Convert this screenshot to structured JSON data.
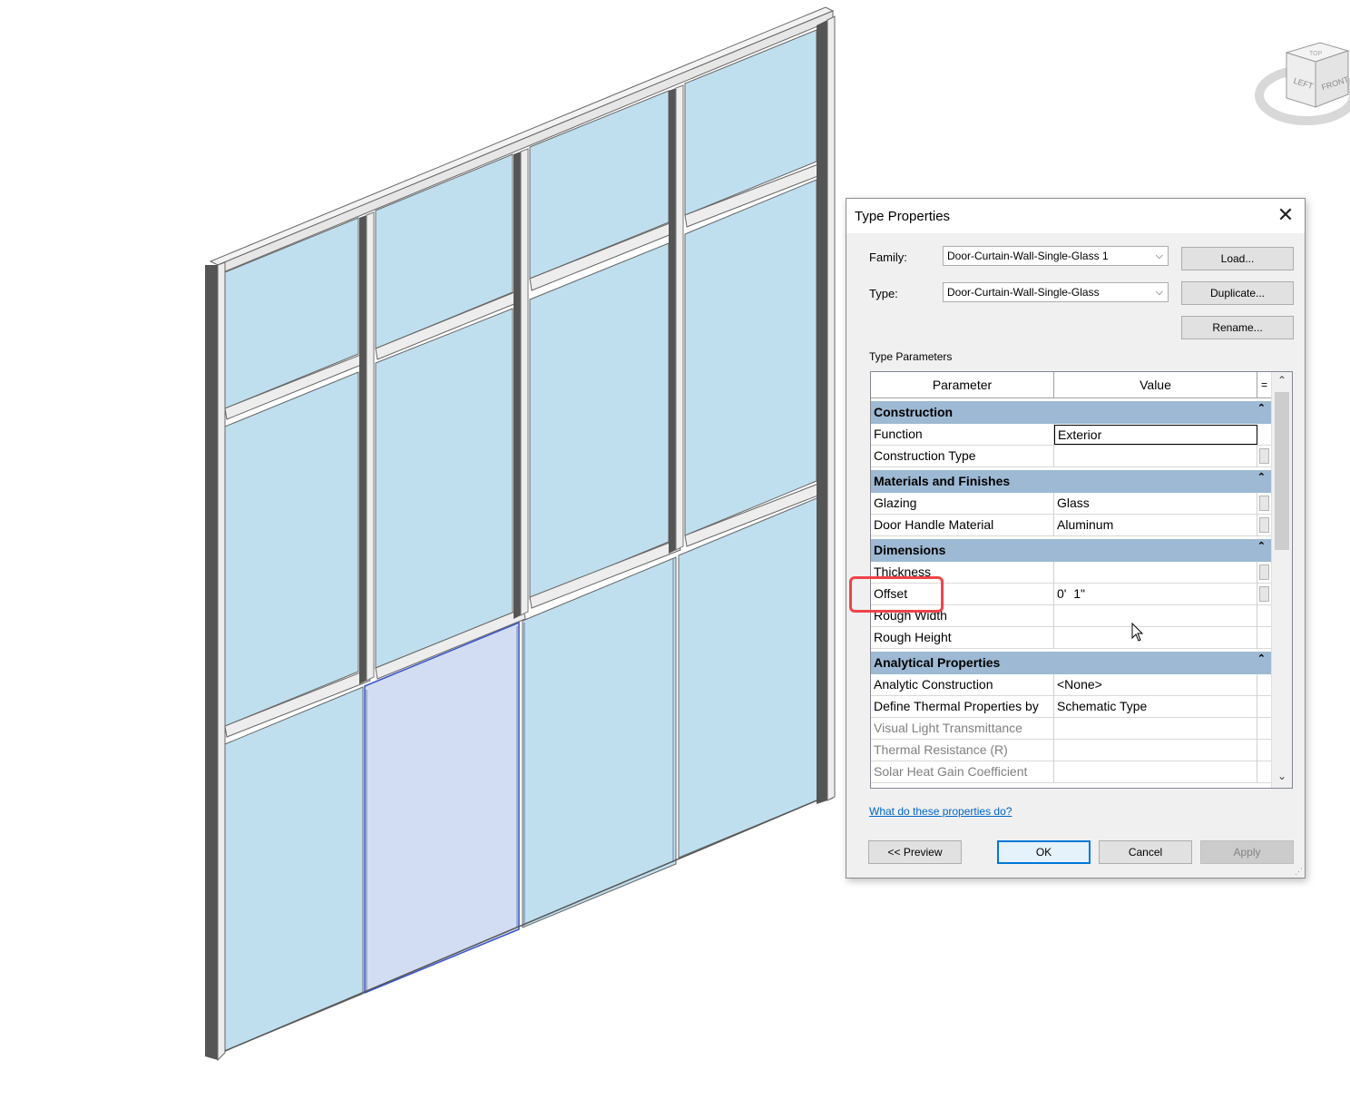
{
  "dialog": {
    "title": "Type Properties",
    "family_label": "Family:",
    "family_value": "Door-Curtain-Wall-Single-Glass 1",
    "type_label": "Type:",
    "type_value": "Door-Curtain-Wall-Single-Glass",
    "load_button": "Load...",
    "duplicate_button": "Duplicate...",
    "rename_button": "Rename...",
    "type_parameters_label": "Type Parameters",
    "columns": {
      "parameter": "Parameter",
      "value": "Value",
      "equals": "="
    },
    "groups": [
      {
        "name": "Construction",
        "rows": [
          {
            "parameter": "Function",
            "value": "Exterior"
          },
          {
            "parameter": "Construction Type",
            "value": ""
          }
        ]
      },
      {
        "name": "Materials and Finishes",
        "rows": [
          {
            "parameter": "Glazing",
            "value": "Glass"
          },
          {
            "parameter": "Door Handle Material",
            "value": "Aluminum"
          }
        ]
      },
      {
        "name": "Dimensions",
        "rows": [
          {
            "parameter": "Thickness",
            "value": ""
          },
          {
            "parameter": "Offset",
            "value": "0'  1\""
          },
          {
            "parameter": "Rough Width",
            "value": ""
          },
          {
            "parameter": "Rough Height",
            "value": ""
          }
        ]
      },
      {
        "name": "Analytical Properties",
        "rows": [
          {
            "parameter": "Analytic Construction",
            "value": "<None>"
          },
          {
            "parameter": "Define Thermal Properties by",
            "value": "Schematic Type"
          },
          {
            "parameter": "Visual Light Transmittance",
            "value": ""
          },
          {
            "parameter": "Thermal Resistance (R)",
            "value": ""
          },
          {
            "parameter": "Solar Heat Gain Coefficient",
            "value": ""
          }
        ]
      }
    ],
    "help_link": "What do these properties do?",
    "preview_button": "<< Preview",
    "ok_button": "OK",
    "cancel_button": "Cancel",
    "apply_button": "Apply"
  },
  "viewcube": {
    "left_face": "LEFT",
    "front_face": "FRONT",
    "top_face": "TOP"
  },
  "colors": {
    "glass": "#bfdfee",
    "selected_panel": "#d2dcf2",
    "mullion_dark": "#555555",
    "group_header": "#9db9d3",
    "highlight": "#f0434a"
  }
}
